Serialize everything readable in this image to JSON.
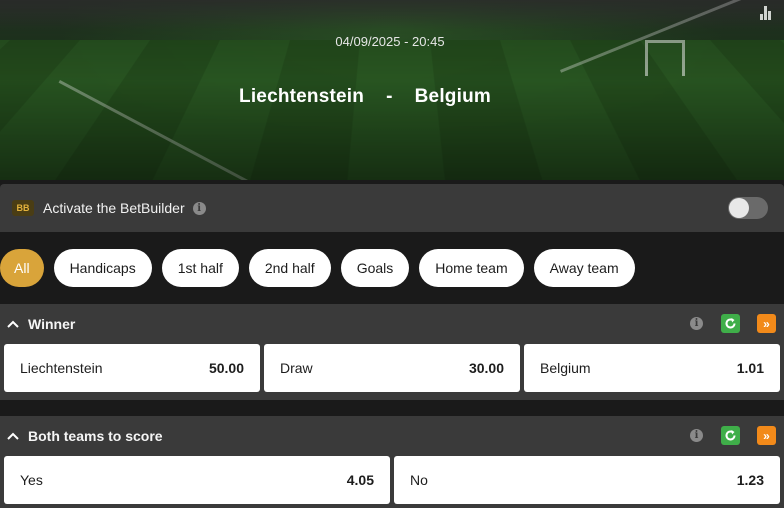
{
  "header": {
    "datetime": "04/09/2025 - 20:45",
    "home_team": "Liechtenstein",
    "separator": "-",
    "away_team": "Belgium",
    "stats_icon": "bar-chart-icon"
  },
  "betbuilder": {
    "badge": "BB",
    "label": "Activate the BetBuilder",
    "info_icon": "i",
    "toggle_on": false
  },
  "filters": [
    {
      "label": "All",
      "active": true
    },
    {
      "label": "Handicaps",
      "active": false
    },
    {
      "label": "1st half",
      "active": false
    },
    {
      "label": "2nd half",
      "active": false
    },
    {
      "label": "Goals",
      "active": false
    },
    {
      "label": "Home team",
      "active": false
    },
    {
      "label": "Away team",
      "active": false
    }
  ],
  "markets": [
    {
      "title": "Winner",
      "info_icon": "i",
      "expand_icon": "»",
      "outcomes": [
        {
          "label": "Liechtenstein",
          "price": "50.00"
        },
        {
          "label": "Draw",
          "price": "30.00"
        },
        {
          "label": "Belgium",
          "price": "1.01"
        }
      ]
    },
    {
      "title": "Both teams to score",
      "info_icon": "i",
      "expand_icon": "»",
      "outcomes": [
        {
          "label": "Yes",
          "price": "4.05"
        },
        {
          "label": "No",
          "price": "1.23"
        }
      ]
    }
  ],
  "colors": {
    "accent": "#d9a43a",
    "panel": "#3a3a3a",
    "green_icon": "#3fae49",
    "orange_icon": "#f28a1a"
  }
}
